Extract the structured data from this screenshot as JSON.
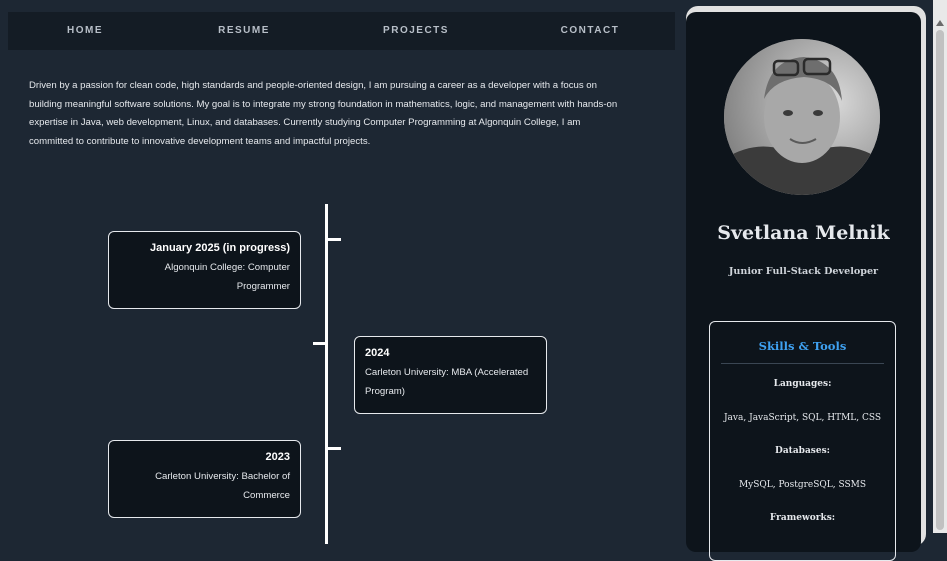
{
  "nav": {
    "items": [
      {
        "label": "HOME"
      },
      {
        "label": "RESUME"
      },
      {
        "label": "PROJECTS"
      },
      {
        "label": "CONTACT"
      }
    ]
  },
  "intro": {
    "text": "Driven by a passion for clean code, high standards and people-oriented design, I am pursuing a career as a developer with a focus on building meaningful software solutions. My goal is to integrate my strong foundation in mathematics, logic, and management with hands-on expertise in Java, web development, Linux, and databases. Currently studying Computer Programming at Algonquin College, I am committed to contribute to innovative development teams and impactful projects."
  },
  "timeline": [
    {
      "title": "January 2025 (in progress)",
      "desc": "Algonquin College: Computer Programmer"
    },
    {
      "title": "2024",
      "desc": "Carleton University: MBA (Accelerated Program)"
    },
    {
      "title": "2023",
      "desc": "Carleton University: Bachelor of Commerce"
    }
  ],
  "sidebar": {
    "name": "Svetlana Melnik",
    "role": "Junior Full-Stack Developer",
    "skills": {
      "title": "Skills & Tools",
      "languages_label": "Languages:",
      "languages": "Java, JavaScript, SQL, HTML, CSS",
      "databases_label": "Databases:",
      "databases": "MySQL, PostgreSQL, SSMS",
      "frameworks_label": "Frameworks:"
    }
  },
  "colors": {
    "background": "#1d2733",
    "panel": "#0d141b",
    "accent": "#3fa2f2"
  }
}
